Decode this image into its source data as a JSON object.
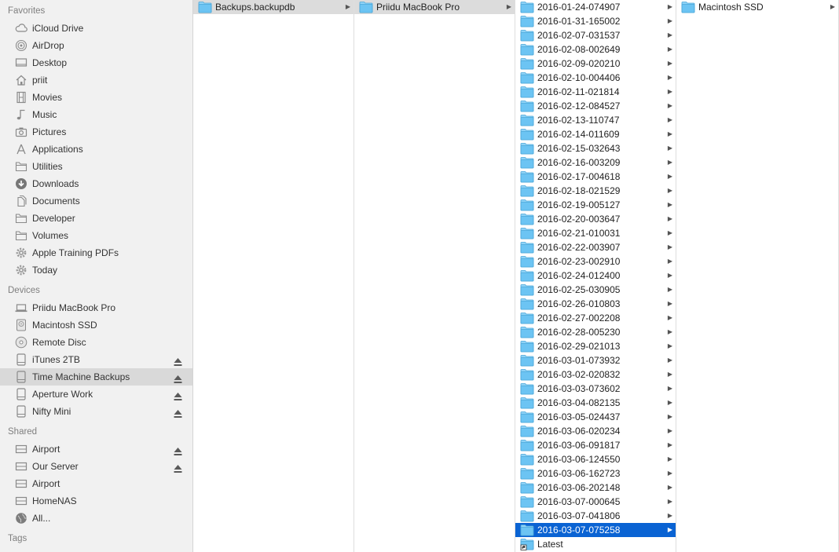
{
  "sidebar": {
    "favorites_header": "Favorites",
    "favorites": [
      {
        "label": "iCloud Drive",
        "icon": "cloud-icon"
      },
      {
        "label": "AirDrop",
        "icon": "airdrop-icon"
      },
      {
        "label": "Desktop",
        "icon": "desktop-icon"
      },
      {
        "label": "priit",
        "icon": "home-icon"
      },
      {
        "label": "Movies",
        "icon": "film-icon"
      },
      {
        "label": "Music",
        "icon": "music-icon"
      },
      {
        "label": "Pictures",
        "icon": "camera-icon"
      },
      {
        "label": "Applications",
        "icon": "applications-icon"
      },
      {
        "label": "Utilities",
        "icon": "folder-icon"
      },
      {
        "label": "Downloads",
        "icon": "download-icon"
      },
      {
        "label": "Documents",
        "icon": "documents-icon"
      },
      {
        "label": "Developer",
        "icon": "folder-icon"
      },
      {
        "label": "Volumes",
        "icon": "folder-icon"
      },
      {
        "label": "Apple Training PDFs",
        "icon": "gear-icon"
      },
      {
        "label": "Today",
        "icon": "gear-icon"
      }
    ],
    "devices_header": "Devices",
    "devices": [
      {
        "label": "Priidu MacBook Pro",
        "icon": "laptop-icon",
        "eject": false
      },
      {
        "label": "Macintosh SSD",
        "icon": "harddisk-icon",
        "eject": false
      },
      {
        "label": "Remote Disc",
        "icon": "disc-icon",
        "eject": false
      },
      {
        "label": "iTunes 2TB",
        "icon": "external-drive-icon",
        "eject": true
      },
      {
        "label": "Time Machine Backups",
        "icon": "external-drive-icon",
        "eject": true,
        "selected": true
      },
      {
        "label": "Aperture Work",
        "icon": "external-drive-icon",
        "eject": true
      },
      {
        "label": "Nifty Mini",
        "icon": "external-drive-icon",
        "eject": true
      }
    ],
    "shared_header": "Shared",
    "shared": [
      {
        "label": "Airport",
        "icon": "server-icon",
        "eject": true
      },
      {
        "label": "Our Server",
        "icon": "server-icon",
        "eject": true
      },
      {
        "label": "Airport",
        "icon": "server-icon",
        "eject": false
      },
      {
        "label": "HomeNAS",
        "icon": "server-icon",
        "eject": false
      },
      {
        "label": "All...",
        "icon": "globe-icon",
        "eject": false
      }
    ],
    "tags_header": "Tags"
  },
  "columns": {
    "col1": [
      {
        "label": "Backups.backupdb",
        "state": "path",
        "arrow": true
      }
    ],
    "col2": [
      {
        "label": "Priidu MacBook Pro",
        "state": "path",
        "arrow": true
      }
    ],
    "col3": [
      {
        "label": "2016-01-24-074907",
        "arrow": true
      },
      {
        "label": "2016-01-31-165002",
        "arrow": true
      },
      {
        "label": "2016-02-07-031537",
        "arrow": true
      },
      {
        "label": "2016-02-08-002649",
        "arrow": true
      },
      {
        "label": "2016-02-09-020210",
        "arrow": true
      },
      {
        "label": "2016-02-10-004406",
        "arrow": true
      },
      {
        "label": "2016-02-11-021814",
        "arrow": true
      },
      {
        "label": "2016-02-12-084527",
        "arrow": true
      },
      {
        "label": "2016-02-13-110747",
        "arrow": true
      },
      {
        "label": "2016-02-14-011609",
        "arrow": true
      },
      {
        "label": "2016-02-15-032643",
        "arrow": true
      },
      {
        "label": "2016-02-16-003209",
        "arrow": true
      },
      {
        "label": "2016-02-17-004618",
        "arrow": true
      },
      {
        "label": "2016-02-18-021529",
        "arrow": true
      },
      {
        "label": "2016-02-19-005127",
        "arrow": true
      },
      {
        "label": "2016-02-20-003647",
        "arrow": true
      },
      {
        "label": "2016-02-21-010031",
        "arrow": true
      },
      {
        "label": "2016-02-22-003907",
        "arrow": true
      },
      {
        "label": "2016-02-23-002910",
        "arrow": true
      },
      {
        "label": "2016-02-24-012400",
        "arrow": true
      },
      {
        "label": "2016-02-25-030905",
        "arrow": true
      },
      {
        "label": "2016-02-26-010803",
        "arrow": true
      },
      {
        "label": "2016-02-27-002208",
        "arrow": true
      },
      {
        "label": "2016-02-28-005230",
        "arrow": true
      },
      {
        "label": "2016-02-29-021013",
        "arrow": true
      },
      {
        "label": "2016-03-01-073932",
        "arrow": true
      },
      {
        "label": "2016-03-02-020832",
        "arrow": true
      },
      {
        "label": "2016-03-03-073602",
        "arrow": true
      },
      {
        "label": "2016-03-04-082135",
        "arrow": true
      },
      {
        "label": "2016-03-05-024437",
        "arrow": true
      },
      {
        "label": "2016-03-06-020234",
        "arrow": true
      },
      {
        "label": "2016-03-06-091817",
        "arrow": true
      },
      {
        "label": "2016-03-06-124550",
        "arrow": true
      },
      {
        "label": "2016-03-06-162723",
        "arrow": true
      },
      {
        "label": "2016-03-06-202148",
        "arrow": true
      },
      {
        "label": "2016-03-07-000645",
        "arrow": true
      },
      {
        "label": "2016-03-07-041806",
        "arrow": true
      },
      {
        "label": "2016-03-07-075258",
        "arrow": true,
        "state": "active"
      },
      {
        "label": "Latest",
        "arrow": false,
        "alias": true
      }
    ],
    "col4": [
      {
        "label": "Macintosh SSD",
        "arrow": true
      }
    ]
  },
  "colors": {
    "selection": "#0a63d3",
    "folder_fill": "#6cc4f3",
    "folder_tab": "#8fd3f7",
    "sidebar_bg": "#f1f1f1"
  }
}
